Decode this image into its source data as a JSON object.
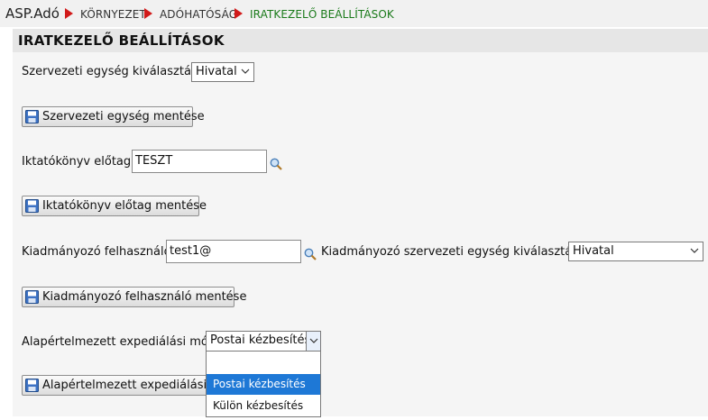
{
  "breadcrumb": {
    "app": "ASP.Adó",
    "items": [
      "KÖRNYEZET",
      "ADÓHATÓSÁG",
      "IRATKEZELŐ BEÁLLÍTÁSOK"
    ]
  },
  "panel": {
    "title": "IRATKEZELŐ BEÁLLÍTÁSOK"
  },
  "org_unit": {
    "label": "Szervezeti egység kiválasztása:",
    "selected": "Hivatal",
    "save_button": "Szervezeti egység mentése"
  },
  "prefix": {
    "label": "Iktatókönyv előtag:",
    "value": "TESZT",
    "save_button": "Iktatókönyv előtag mentése"
  },
  "issuer": {
    "user_label": "Kiadmányozó felhasználó:",
    "user_value": "test1@",
    "org_label": "Kiadmányozó szervezeti egység kiválasztása:",
    "org_selected": "Hivatal",
    "save_button": "Kiadmányozó felhasználó mentése"
  },
  "expedition": {
    "label": "Alapértelmezett expediálási mód:",
    "selected": "Postai kézbesítés",
    "save_button_visible": "Alapértelmezett expediálási m",
    "options": [
      "Postai kézbesítés",
      "Külön kézbesítés"
    ]
  },
  "colors": {
    "arrow_red": "#d11a1a",
    "active_green": "#1a7a1a",
    "selection_blue": "#1e78d6"
  },
  "icons": {
    "save": "floppy-disk-icon",
    "search": "magnifier-icon",
    "chevron": "chevron-down-icon"
  }
}
